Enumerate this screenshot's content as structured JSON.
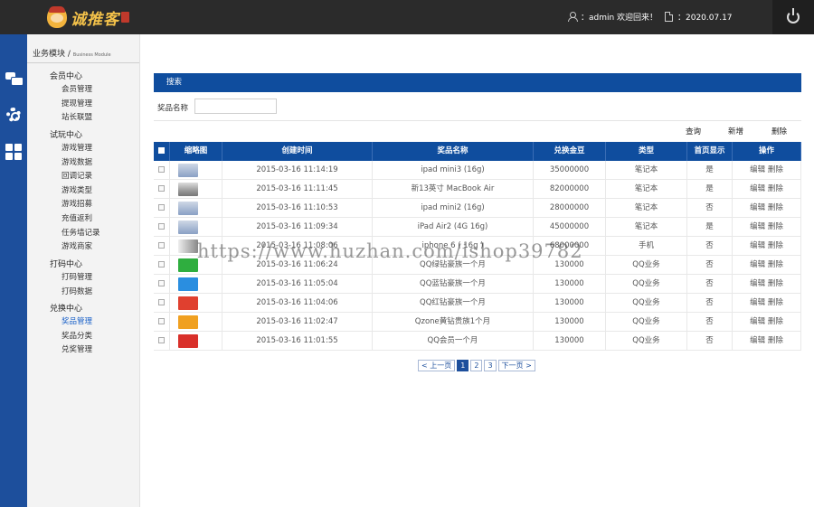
{
  "header": {
    "logo_text": "诚推客",
    "user_text": "：admin 欢迎回来！",
    "date_text": "：2020.07.17"
  },
  "sidebar": {
    "module_title": "业务模块",
    "module_separator": " / ",
    "module_subtitle": "Business Module",
    "groups": [
      {
        "label": "会员中心",
        "items": [
          "会员管理",
          "提现管理",
          "站长联盟"
        ]
      },
      {
        "label": "试玩中心",
        "items": [
          "游戏管理",
          "游戏数据",
          "回调记录",
          "游戏类型",
          "游戏招募",
          "充值返利",
          "任务墙记录",
          "游戏商家"
        ]
      },
      {
        "label": "打码中心",
        "items": [
          "打码管理",
          "打码数据"
        ]
      },
      {
        "label": "兑换中心",
        "items": [
          "奖品管理",
          "奖品分类",
          "兑奖管理"
        ]
      }
    ]
  },
  "panel": {
    "title": "搜索",
    "search_label": "奖品名称",
    "search_value": "",
    "search_placeholder": ""
  },
  "actions": {
    "query": "查询",
    "add": "新增",
    "delete": "删除"
  },
  "table": {
    "headers": [
      "",
      "缩略图",
      "创建时间",
      "奖品名称",
      "兑换金豆",
      "类型",
      "首页显示",
      "操作"
    ],
    "rows": [
      {
        "time": "2015-03-16 11:14:19",
        "name": "ipad mini3 (16g)",
        "beans": "35000000",
        "type": "笔记本",
        "home": "是",
        "thumb": "th-tablet"
      },
      {
        "time": "2015-03-16 11:11:45",
        "name": "新13英寸 MacBook Air",
        "beans": "82000000",
        "type": "笔记本",
        "home": "是",
        "thumb": "th-laptop"
      },
      {
        "time": "2015-03-16 11:10:53",
        "name": "ipad mini2 (16g)",
        "beans": "28000000",
        "type": "笔记本",
        "home": "否",
        "thumb": "th-tablet"
      },
      {
        "time": "2015-03-16 11:09:34",
        "name": "iPad Air2 (4G 16g)",
        "beans": "45000000",
        "type": "笔记本",
        "home": "是",
        "thumb": "th-tablet"
      },
      {
        "time": "2015-03-16 11:08:06",
        "name": "iphone 6 ( 16g )",
        "beans": "68000000",
        "type": "手机",
        "home": "否",
        "thumb": "th-phone"
      },
      {
        "time": "2015-03-16 11:06:24",
        "name": "QQ绿钻豪族一个月",
        "beans": "130000",
        "type": "QQ业务",
        "home": "否",
        "thumb": "th-green"
      },
      {
        "time": "2015-03-16 11:05:04",
        "name": "QQ蓝钻豪族一个月",
        "beans": "130000",
        "type": "QQ业务",
        "home": "否",
        "thumb": "th-blue"
      },
      {
        "time": "2015-03-16 11:04:06",
        "name": "QQ红钻豪族一个月",
        "beans": "130000",
        "type": "QQ业务",
        "home": "否",
        "thumb": "th-red"
      },
      {
        "time": "2015-03-16 11:02:47",
        "name": "Qzone黄钻贵族1个月",
        "beans": "130000",
        "type": "QQ业务",
        "home": "否",
        "thumb": "th-orange"
      },
      {
        "time": "2015-03-16 11:01:55",
        "name": "QQ会员一个月",
        "beans": "130000",
        "type": "QQ业务",
        "home": "否",
        "thumb": "th-redq"
      }
    ],
    "op_edit": "编辑",
    "op_delete": "删除"
  },
  "pager": {
    "prev": "< 上一页",
    "pages": [
      "1",
      "2",
      "3"
    ],
    "next": "下一页 >"
  },
  "watermark": "https://www.huzhan.com/ishop39782"
}
